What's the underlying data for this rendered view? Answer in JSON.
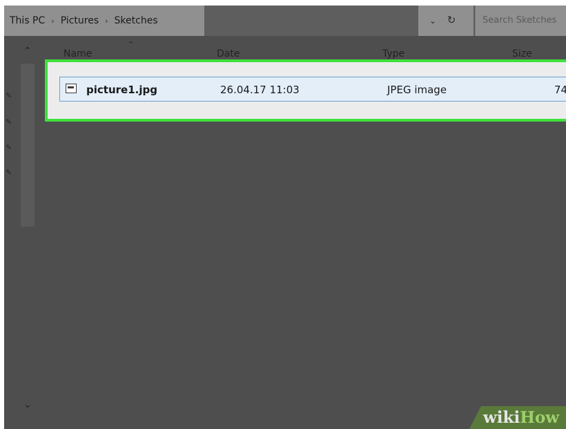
{
  "address_bar": {
    "breadcrumb": [
      "This PC",
      "Pictures",
      "Sketches"
    ],
    "separator": "›",
    "search_placeholder": "Search Sketches"
  },
  "icons": {
    "dropdown": "⌄",
    "refresh": "↻",
    "scroll_up": "⌃",
    "scroll_down": "⌄",
    "pin": "✎",
    "sort": "⌃"
  },
  "columns": [
    "Name",
    "Date",
    "Type",
    "Size"
  ],
  "files": [
    {
      "name": "picture1.jpg",
      "date": "26.04.17 11:03",
      "type": "JPEG image",
      "size": "74"
    }
  ],
  "watermark": {
    "part1": "wiki",
    "part2": "How"
  },
  "colors": {
    "highlight": "#3fe03a",
    "selection_border": "#6a9fd2",
    "selection_fill": "#e3eef9"
  }
}
